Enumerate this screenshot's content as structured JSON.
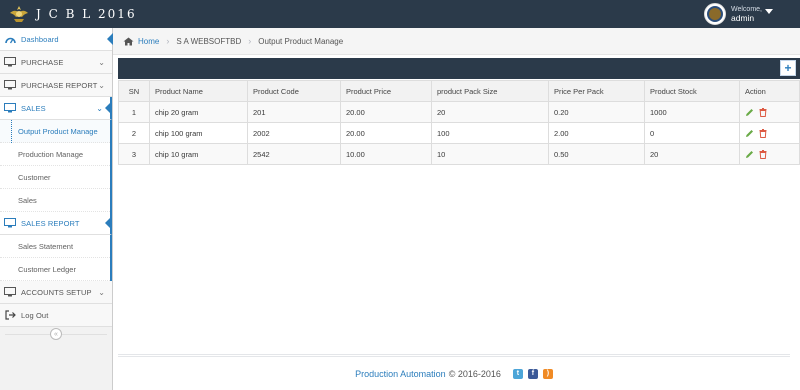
{
  "header": {
    "title": "J C B L 2016",
    "welcome": "Welcome,",
    "username": "admin"
  },
  "sidebar": {
    "items": [
      {
        "label": "Dashboard"
      },
      {
        "label": "PURCHASE"
      },
      {
        "label": "PURCHASE REPORT"
      },
      {
        "label": "SALES"
      },
      {
        "label": "SALES REPORT"
      },
      {
        "label": "ACCOUNTS SETUP"
      },
      {
        "label": "Log Out"
      }
    ],
    "sales_sub": [
      "Output Product Manage",
      "Production Manage",
      "Customer",
      "Sales"
    ],
    "sales_report_sub": [
      "Sales Statement",
      "Customer Ledger"
    ],
    "collapse_icon": "«"
  },
  "breadcrumb": {
    "home": "Home",
    "level1": "S A WEBSOFTBD",
    "level2": "Output Product Manage"
  },
  "toolbar": {
    "add_label": "+"
  },
  "table": {
    "headers": [
      "SN",
      "Product Name",
      "Product Code",
      "Product Price",
      "product Pack Size",
      "Price Per Pack",
      "Product Stock",
      "Action"
    ],
    "rows": [
      [
        "1",
        "chip 20 gram",
        "201",
        "20.00",
        "20",
        "0.20",
        "1000"
      ],
      [
        "2",
        "chip 100 gram",
        "2002",
        "20.00",
        "100",
        "2.00",
        "0"
      ],
      [
        "3",
        "chip 10 gram",
        "2542",
        "10.00",
        "10",
        "0.50",
        "20"
      ]
    ]
  },
  "footer": {
    "brand": "Production Automation",
    "copyright": "© 2016-2016"
  },
  "colors": {
    "navbar": "#2b3a4a",
    "accent": "#2b7dbc",
    "edit": "#69aa46",
    "delete": "#dd5a43"
  },
  "icons": [
    "crest-logo",
    "user-avatar",
    "chevron-down-icon",
    "dashboard-icon",
    "monitor-icon",
    "logout-icon",
    "home-icon",
    "plus-icon",
    "pencil-icon",
    "trash-icon",
    "twitter-icon",
    "facebook-icon",
    "rss-icon"
  ]
}
